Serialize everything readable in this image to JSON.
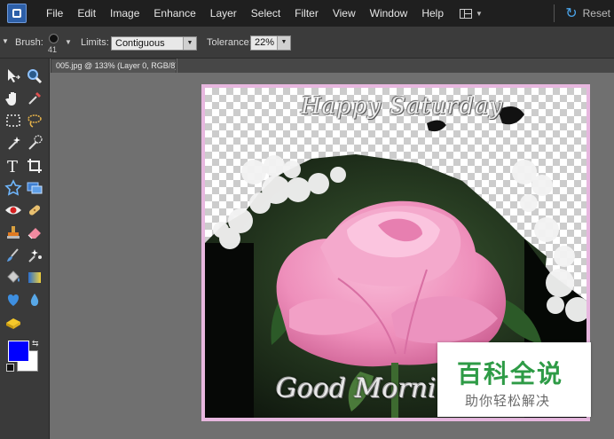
{
  "menubar": {
    "items": [
      "File",
      "Edit",
      "Image",
      "Enhance",
      "Layer",
      "Select",
      "Filter",
      "View",
      "Window",
      "Help"
    ],
    "reset_label": "Reset"
  },
  "options": {
    "brush_label": "Brush:",
    "brush_size": "41",
    "limits_label": "Limits:",
    "limits_value": "Contiguous",
    "tolerance_label": "Tolerance:",
    "tolerance_value": "22%"
  },
  "document": {
    "tab_title": "005.jpg @ 133% (Layer 0, RGB/8) *"
  },
  "canvas": {
    "top_text": "Happy Saturday",
    "bottom_text": "Good Morning"
  },
  "colors": {
    "foreground": "#0000ff",
    "background": "#ffffff",
    "accent": "#4aa3e8",
    "watermark_green": "#2e9b46"
  },
  "watermark": {
    "main": "百科全说",
    "sub": "助你轻松解决"
  },
  "tools": [
    "move-icon",
    "zoom-icon",
    "hand-icon",
    "eyedropper-icon",
    "marquee-icon",
    "lasso-icon",
    "magic-wand-icon",
    "quick-selection-icon",
    "type-icon",
    "crop-icon",
    "cookie-cutter-icon",
    "recompose-icon",
    "red-eye-icon",
    "spot-healing-icon",
    "clone-stamp-icon",
    "eraser-icon",
    "brush-icon",
    "smart-brush-icon",
    "paint-bucket-icon",
    "gradient-icon",
    "custom-shape-icon",
    "blur-icon",
    "sponge-icon"
  ]
}
